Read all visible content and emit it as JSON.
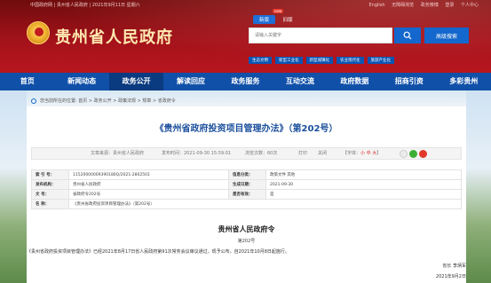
{
  "topbar": {
    "left": "中国政府网 | 贵州省人民政府 | 2021年9月11日 星期六",
    "links": [
      "English",
      "无障碍浏览",
      "政务微博",
      "登录",
      "个人中心"
    ]
  },
  "site": {
    "title": "贵州省人民政府"
  },
  "version_tabs": {
    "new": "新版",
    "old": "旧版",
    "badge": "new"
  },
  "search": {
    "placeholder": "请输入关键字",
    "advanced": "高级搜索"
  },
  "tags": [
    "生态文明",
    "新型工业化",
    "新型城镇化",
    "农业现代化",
    "旅游产业化"
  ],
  "nav": [
    "首页",
    "新闻动态",
    "政务公开",
    "解读回应",
    "政务服务",
    "互动交流",
    "政府数据",
    "招商引资",
    "多彩贵州"
  ],
  "nav_active": "政务公开",
  "breadcrumb": "您当前所在的位置: 首页 > 政务公开 > 政策法规 > 规章 > 省政府令",
  "article": {
    "title": "《贵州省政府投资项目管理办法》（第202号）",
    "meta": {
      "source": "文章来源：贵州省人民政府",
      "date": "发布时间：2021-09-30 15:59:01",
      "views": "浏览次数：60次",
      "print": "打印",
      "close": "关闭",
      "font": "【字体：",
      "font_sizes": "小 中 大",
      "font_end": "】"
    },
    "info": {
      "r1": [
        "索 引 号：",
        "11520000009390180Q/2021-2802501",
        "信息分类：",
        "政策文件  其他"
      ],
      "r2": [
        "发布机构：",
        "贵州省人民政府",
        "生成日期：",
        "2021-09-30"
      ],
      "r3": [
        "文    号：",
        "省政府令202号",
        "是否有效：",
        "是"
      ],
      "r4": [
        "名    称：",
        "《贵州省政府投资项目管理办法》（第202号）"
      ]
    },
    "doc_head": "贵州省人民政府令",
    "doc_no": "第202号",
    "body": "《贵州省政府投资项目管理办法》已经2021年8月17日省人民政府第91次常务会议审议通过，现予公布，自2021年10月8日起施行。",
    "sign": "省长  李炳军",
    "date": "2021年9月2日"
  },
  "colors": {
    "header_red": "#a3121a",
    "nav_blue": "#1050a8",
    "title_blue": "#1b4f9c",
    "accent": "#1467cc"
  }
}
